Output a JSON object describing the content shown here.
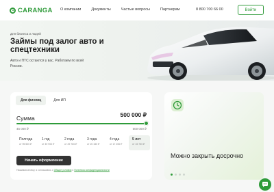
{
  "brand": {
    "name": "CARANGA",
    "accent": "#2f9b3a"
  },
  "nav": {
    "items": [
      {
        "label": "О компании"
      },
      {
        "label": "Документы"
      },
      {
        "label": "Частые вопросы"
      },
      {
        "label": "Партнерам"
      }
    ],
    "phone": "8 800 700 66 00",
    "login_label": "Войти"
  },
  "hero": {
    "tag": "Для бизнеса и людей",
    "title": "Займы под залог авто и спецтехники",
    "subtitle": "Авто и ПТС остаются у вас. Работаем по всей России."
  },
  "calculator": {
    "tabs": [
      {
        "label": "Для физлиц"
      },
      {
        "label": "Для ИП"
      }
    ],
    "active_tab": 0,
    "sum_label": "Сумма",
    "sum_value": "500 000 ₽",
    "min_label": "45 000 ₽",
    "max_label": "500 000 ₽",
    "slider_fraction": 1.0,
    "terms": [
      {
        "label": "Полгода",
        "payment": "от 95 500 ₽"
      },
      {
        "label": "1 год",
        "payment": "от 49 900 ₽"
      },
      {
        "label": "2 года",
        "payment": "от 29 760 ₽"
      },
      {
        "label": "3 года",
        "payment": "от 20 150 ₽"
      },
      {
        "label": "4 года",
        "payment": "от 17 250 ₽"
      },
      {
        "label": "5 лет",
        "payment": "от 15 750 ₽"
      }
    ],
    "active_term": 5,
    "start_label": "Начать оформление",
    "disclaimer_text": "Нажимая кнопку, я соглашаюсь с ",
    "disclaimer_link1": "Общие условия",
    "disclaimer_mid": " и ",
    "disclaimer_link2": "Политика конфиденциальности"
  },
  "promo": {
    "title": "Можно закрыть досрочно",
    "slides": 4,
    "active_slide": 0
  }
}
